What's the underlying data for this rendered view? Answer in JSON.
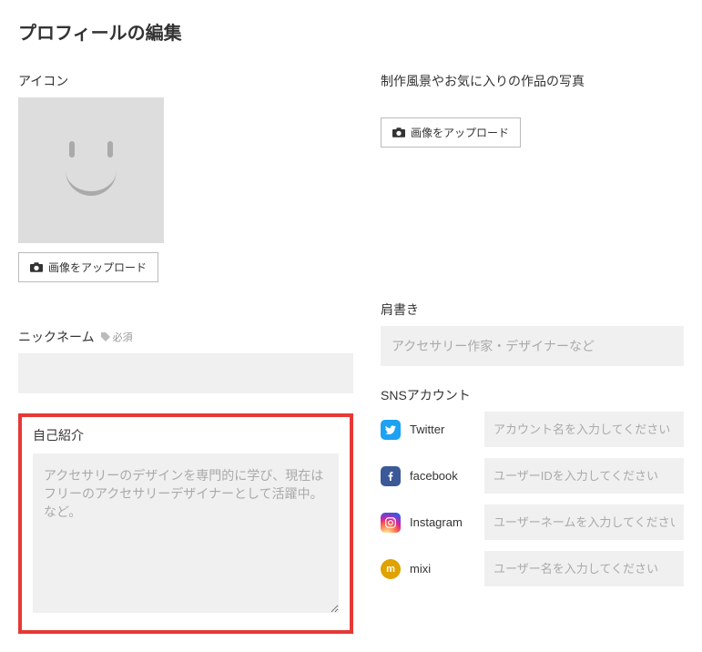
{
  "page": {
    "title": "プロフィールの編集"
  },
  "avatar": {
    "label": "アイコン",
    "upload_label": "画像をアップロード"
  },
  "photo": {
    "label": "制作風景やお気に入りの作品の写真",
    "upload_label": "画像をアップロード"
  },
  "nickname": {
    "label": "ニックネーム",
    "required_text": "必須",
    "value": ""
  },
  "titlefield": {
    "label": "肩書き",
    "placeholder": "アクセサリー作家・デザイナーなど",
    "value": ""
  },
  "bio": {
    "label": "自己紹介",
    "placeholder": "アクセサリーのデザインを専門的に学び、現在はフリーのアクセサリーデザイナーとして活躍中。など。",
    "value": ""
  },
  "sns": {
    "label": "SNSアカウント",
    "twitter": {
      "label": "Twitter",
      "placeholder": "アカウント名を入力してください",
      "value": ""
    },
    "facebook": {
      "label": "facebook",
      "placeholder": "ユーザーIDを入力してください",
      "value": ""
    },
    "instagram": {
      "label": "Instagram",
      "placeholder": "ユーザーネームを入力してください",
      "value": ""
    },
    "mixi": {
      "label": "mixi",
      "placeholder": "ユーザー名を入力してください",
      "value": ""
    }
  }
}
